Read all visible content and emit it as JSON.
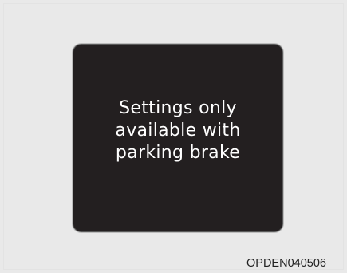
{
  "display": {
    "message_lines": [
      "Settings only",
      "available with",
      "parking brake"
    ]
  },
  "figure_code": "OPDEN040506"
}
